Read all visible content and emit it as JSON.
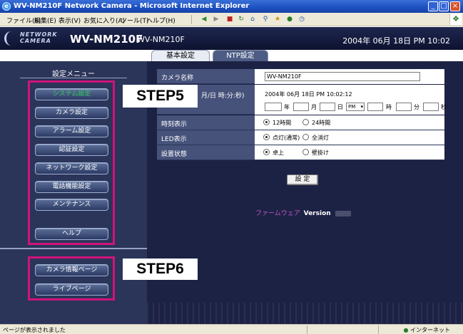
{
  "window": {
    "title": "WV-NM210F Network Camera - Microsoft Internet Explorer",
    "minimize": "_",
    "maximize": "□",
    "close": "×"
  },
  "menubar": {
    "items": [
      "ファイル(F)",
      "編集(E)",
      "表示(V)",
      "お気に入り(A)",
      "ツール(T)",
      "ヘルプ(H)"
    ]
  },
  "toolbar": {
    "icons": [
      "back-icon",
      "forward-icon",
      "stop-icon",
      "refresh-icon",
      "home-icon",
      "search-icon",
      "favorites-icon",
      "media-icon",
      "history-icon"
    ]
  },
  "camera_header": {
    "logo_line1": "NETWORK",
    "logo_line2": "CAMERA",
    "model_big": "WV-NM210F",
    "model_small": "WV-NM210F",
    "datetime": "2004年 06月 18日 PM 10:02"
  },
  "tabs": {
    "basic": "基本設定",
    "ntp": "NTP設定"
  },
  "sidebar": {
    "heading": "設定メニュー",
    "items": [
      "システム設定",
      "カメラ設定",
      "アラーム設定",
      "認証設定",
      "ネットワーク設定",
      "電話機能設定",
      "メンテナンス",
      "ヘルプ"
    ],
    "bottom_items": [
      "カメラ情報ページ",
      "ライブページ"
    ]
  },
  "annotations": {
    "step5": "STEP5",
    "step6": "STEP6"
  },
  "form": {
    "camera_name_label": "カメラ名称",
    "camera_name_value": "WV-NM210F",
    "datetime_label": "月/日 時:分:秒)",
    "current_datetime": "2004年  06月  18日   PM  10:02:12",
    "unit_year": "年",
    "unit_month": "月",
    "unit_day": "日",
    "ampm": "PM",
    "unit_hour": "時",
    "unit_min": "分",
    "unit_sec": "秒",
    "time_display_label": "時刻表示",
    "time_options": [
      "12時間",
      "24時間"
    ],
    "led_label": "LED表示",
    "led_options": [
      "点灯(通常)",
      "全消灯"
    ],
    "install_label": "設置状態",
    "install_options": [
      "卓上",
      "壁掛け"
    ],
    "set_button": "設 定",
    "firmware_label": "ファームウェア",
    "firmware_version_label": "Version"
  },
  "statusbar": {
    "left": "ページが表示されました",
    "right": "インターネット"
  },
  "colors": {
    "highlight": "#d01479",
    "active_nav": "#30d05a",
    "firmware": "#c25bc6"
  }
}
